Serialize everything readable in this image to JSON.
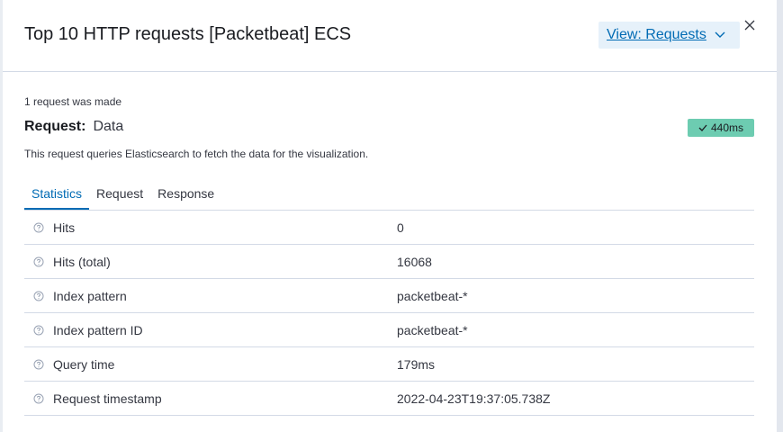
{
  "header": {
    "title": "Top 10 HTTP requests [Packetbeat] ECS",
    "view_button_label": "View: Requests"
  },
  "request": {
    "count_text": "1 request was made",
    "label_key": "Request:",
    "label_value": "Data",
    "time_badge": "440ms",
    "description": "This request queries Elasticsearch to fetch the data for the visualization."
  },
  "tabs": [
    {
      "label": "Statistics",
      "active": true
    },
    {
      "label": "Request",
      "active": false
    },
    {
      "label": "Response",
      "active": false
    }
  ],
  "statistics": [
    {
      "name": "Hits",
      "value": "0"
    },
    {
      "name": "Hits (total)",
      "value": "16068"
    },
    {
      "name": "Index pattern",
      "value": "packetbeat-*"
    },
    {
      "name": "Index pattern ID",
      "value": "packetbeat-*"
    },
    {
      "name": "Query time",
      "value": "179ms"
    },
    {
      "name": "Request timestamp",
      "value": "2022-04-23T19:37:05.738Z"
    }
  ],
  "icons": {
    "close": "close-icon",
    "dropdown": "chevron-down-icon",
    "check": "check-icon",
    "help": "question-circle-icon"
  },
  "colors": {
    "accent": "#006bb4",
    "badge_success": "#6dccb1",
    "view_button_bg": "#e6f1fa",
    "border": "#d3dae6"
  }
}
